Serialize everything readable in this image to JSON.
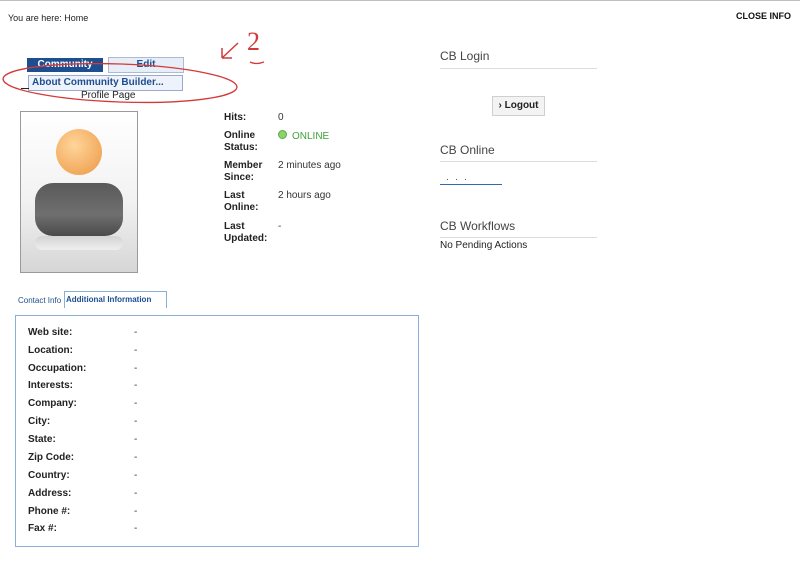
{
  "breadcrumb": "You are here: Home",
  "close_info": "CLOSE INFO",
  "menu": {
    "community": "Community",
    "edit": "Edit",
    "dropdown_item": "About Community Builder...",
    "profile_page": "Profile Page"
  },
  "annotation_text": "2",
  "profile_fields": [
    {
      "label": "Hits:",
      "value": "0"
    },
    {
      "label": "Online Status:",
      "value": "ONLINE"
    },
    {
      "label": "Member Since:",
      "value": "2 minutes ago"
    },
    {
      "label": "Last Online:",
      "value": "2 hours ago"
    },
    {
      "label": "Last Updated:",
      "value": "-"
    }
  ],
  "modules": {
    "login_title": "CB Login",
    "logout": "Logout",
    "online_title": "CB Online",
    "workflows_title": "CB Workflows",
    "no_pending": "No Pending Actions"
  },
  "tabs": {
    "contact": "Contact Info",
    "additional": "Additional Information"
  },
  "additional_info": [
    {
      "label": "Web site:",
      "value": "-"
    },
    {
      "label": "Location:",
      "value": "-"
    },
    {
      "label": "Occupation:",
      "value": "-"
    },
    {
      "label": "Interests:",
      "value": "-"
    },
    {
      "label": "Company:",
      "value": "-"
    },
    {
      "label": "City:",
      "value": "-"
    },
    {
      "label": "State:",
      "value": "-"
    },
    {
      "label": "Zip Code:",
      "value": "-"
    },
    {
      "label": "Country:",
      "value": "-"
    },
    {
      "label": "Address:",
      "value": "-"
    },
    {
      "label": "Phone #:",
      "value": "-"
    },
    {
      "label": "Fax #:",
      "value": "-"
    }
  ],
  "colors": {
    "menu_accent": "#1d4e8f",
    "online_green": "#3fa23a",
    "tab_border": "#8ab0d6"
  }
}
